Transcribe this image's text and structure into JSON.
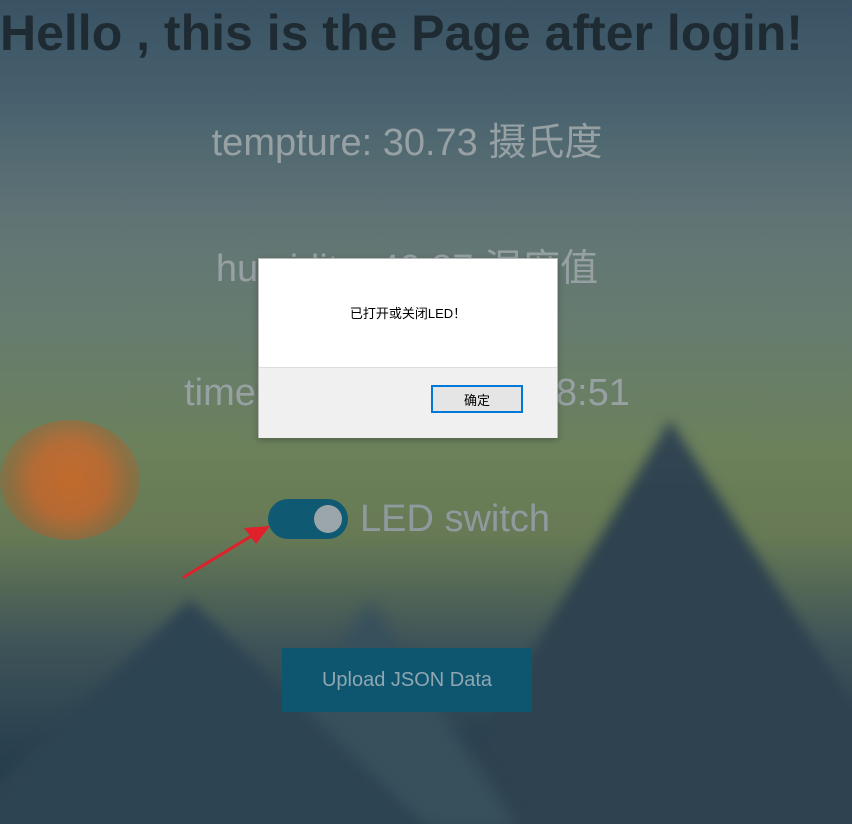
{
  "page": {
    "title": "Hello , this is the Page after login!"
  },
  "readings": {
    "temperature": "tempture: 30.73 摄氏度",
    "humidity": "humidity: 40.87 湿度值",
    "time": "time: 2019-05-15 22:38:51"
  },
  "led": {
    "label": "LED switch",
    "state": "on"
  },
  "upload": {
    "label": "Upload JSON Data"
  },
  "dialog": {
    "message": "已打开或关闭LED！",
    "ok_label": "确定"
  },
  "colors": {
    "toggle_on": "#0f5973",
    "button_bg": "#0e5570",
    "annotation_arrow": "#e0202a"
  }
}
